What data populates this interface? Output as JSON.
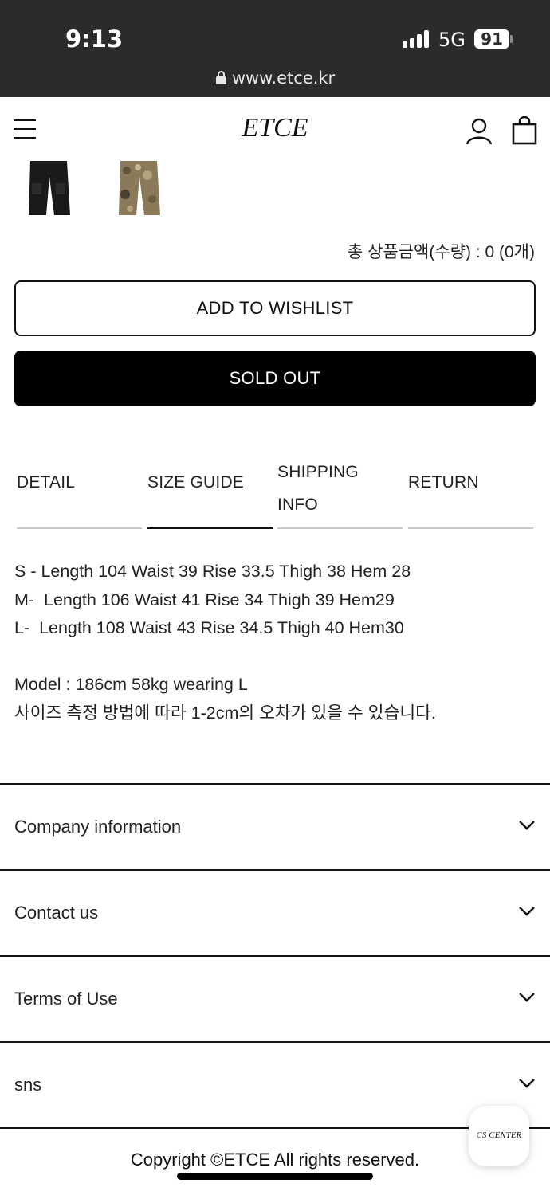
{
  "status_bar": {
    "time": "9:13",
    "network": "5G",
    "battery": "91",
    "url": "www.etce.kr"
  },
  "header": {
    "logo": "ETCE",
    "icons": [
      "menu-icon",
      "user-icon",
      "shopping-bag-icon"
    ]
  },
  "product": {
    "thumbnails": [
      {
        "name": "black-cargo-pants",
        "color": "#1a1a1a"
      },
      {
        "name": "camo-cargo-pants",
        "color": "#8a7a5a"
      }
    ],
    "total_label": "총 상품금액(수량) : 0 (0개)"
  },
  "actions": {
    "wishlist_label": "ADD TO WISHLIST",
    "soldout_label": "SOLD OUT"
  },
  "tabs": [
    {
      "label": "DETAIL",
      "active": false
    },
    {
      "label": "SIZE GUIDE",
      "active": true
    },
    {
      "label": "SHIPPING\nINFO",
      "active": false
    },
    {
      "label": "RETURN",
      "active": false
    }
  ],
  "size_guide": {
    "text": "S - Length 104 Waist 39 Rise 33.5 Thigh 38 Hem 28\nM-  Length 106 Waist 41 Rise 34 Thigh 39 Hem29\nL-  Length 108 Waist 43 Rise 34.5 Thigh 40 Hem30\n\nModel : 186cm 58kg wearing L\n사이즈 측정 방법에 따라 1-2cm의 오차가 있을 수 있습니다."
  },
  "footer": {
    "sections": [
      {
        "label": "Company information"
      },
      {
        "label": "Contact us"
      },
      {
        "label": "Terms of Use"
      },
      {
        "label": "sns"
      }
    ],
    "copyright": "Copyright ©ETCE All rights reserved.",
    "cs_center": "CS CENTER"
  },
  "colors": {
    "status_bar_bg": "#2b2b2b",
    "primary": "#000000",
    "tab_inactive_line": "#c8c8c8"
  }
}
